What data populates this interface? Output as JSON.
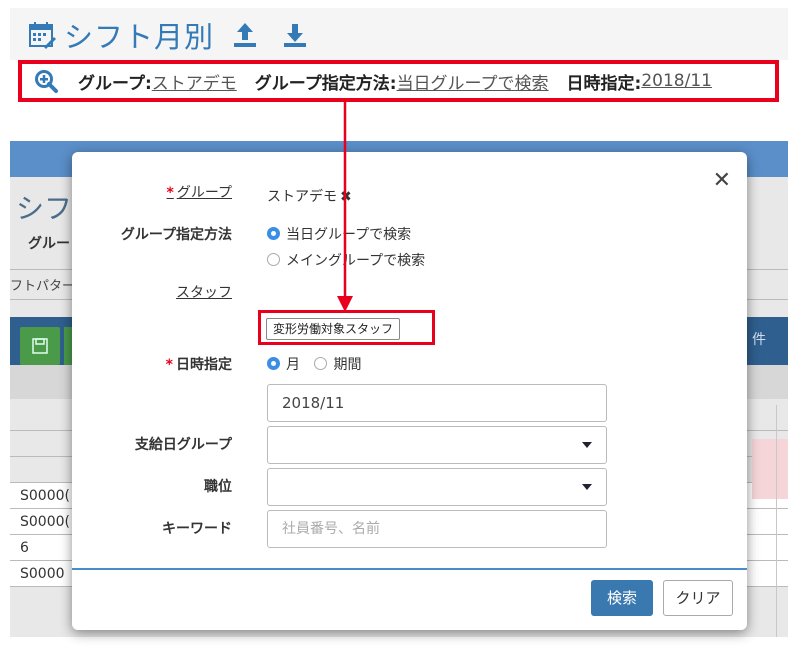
{
  "header": {
    "title": "シフト月別",
    "upload_icon": "upload-icon",
    "download_icon": "download-icon",
    "accent_color": "#337ab7"
  },
  "condition_bar": {
    "group_label": "グループ:",
    "group_value": "ストアデモ",
    "method_label": "グループ指定方法:",
    "method_value": " 当日グループで検索",
    "date_label": "日時指定:",
    "date_value": "2018/11",
    "highlight_color": "#e8001c"
  },
  "background": {
    "title": "シフ",
    "group_label": "グルー",
    "pattern_label": "フトパター",
    "right_label": "件",
    "rows": [
      "S0000(",
      "S0000(",
      "6",
      "S0000"
    ]
  },
  "modal": {
    "group": {
      "required": "*",
      "label": "グループ",
      "value": "ストアデモ",
      "remove": "✖"
    },
    "method": {
      "label": "グループ指定方法",
      "options": [
        {
          "label": "当日グループで検索",
          "selected": true
        },
        {
          "label": "メイングループで検索",
          "selected": false
        }
      ]
    },
    "staff": {
      "label": "スタッフ",
      "button": "変形労働対象スタッフ"
    },
    "date": {
      "required": "*",
      "label": "日時指定",
      "options": [
        {
          "label": "月",
          "selected": true
        },
        {
          "label": "期間",
          "selected": false
        }
      ],
      "value": "2018/11"
    },
    "pay_group": {
      "label": "支給日グループ",
      "value": ""
    },
    "position": {
      "label": "職位",
      "value": ""
    },
    "keyword": {
      "label": "キーワード",
      "placeholder": "社員番号、名前"
    },
    "search_button": "検索",
    "clear_button": "クリア",
    "close": "✕"
  }
}
